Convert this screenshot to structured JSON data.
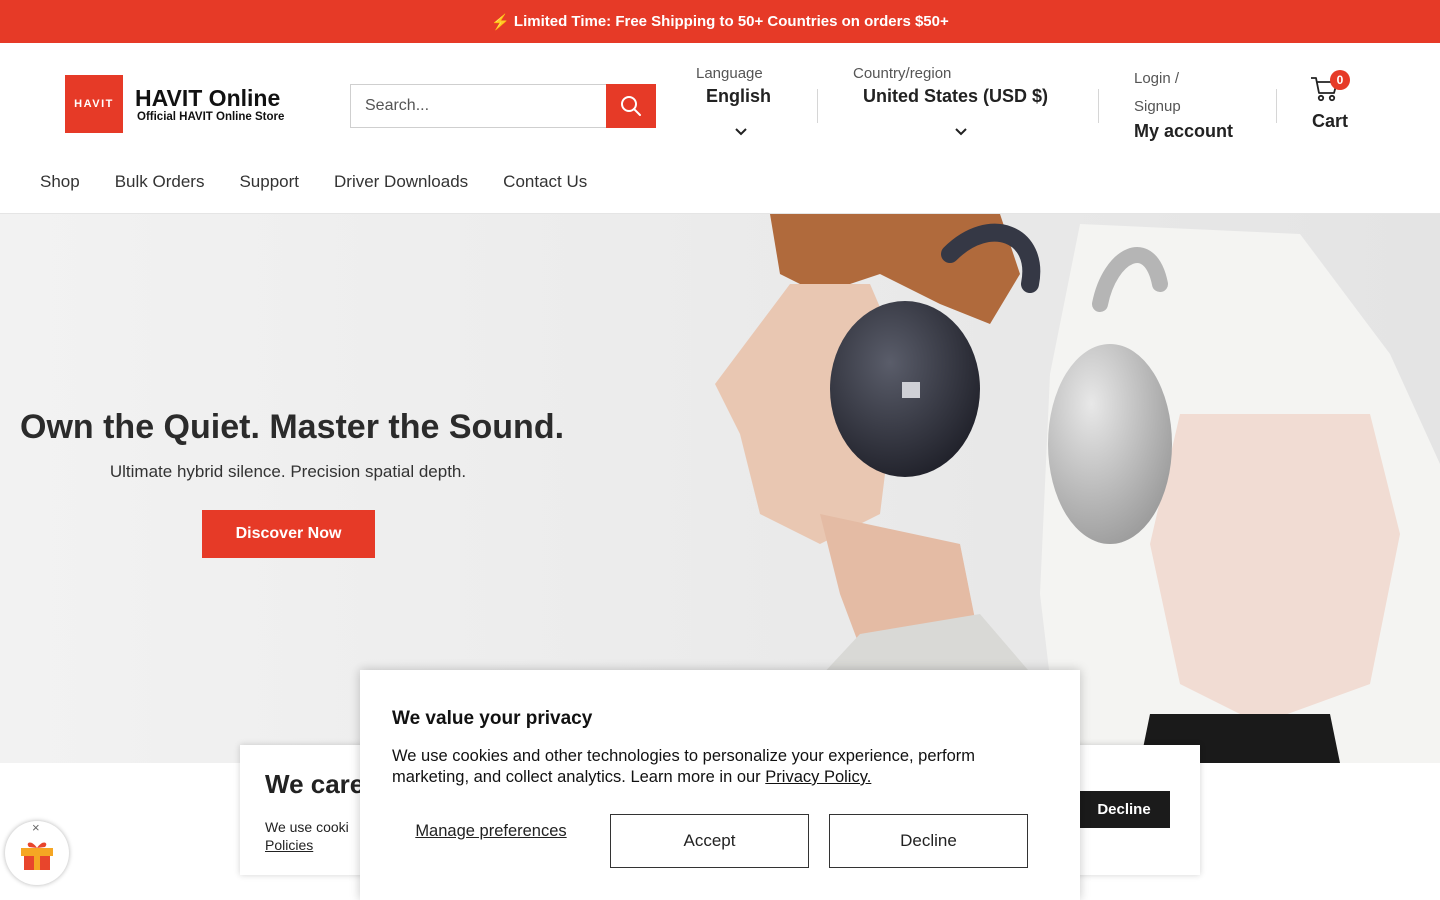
{
  "promo": {
    "icon": "lightning-icon",
    "bolt": "⚡",
    "text": "Limited Time: Free Shipping to 50+ Countries on orders $50+"
  },
  "header": {
    "logo": {
      "box_text": "HAVIT",
      "title": "HAVIT Online",
      "subtitle": "Official HAVIT Online Store"
    },
    "search": {
      "placeholder": "Search..."
    },
    "language": {
      "label": "Language",
      "value": "English"
    },
    "region": {
      "label": "Country/region",
      "value": "United States (USD $)"
    },
    "account": {
      "login": "Login / Signup",
      "my_account": "My account"
    },
    "cart": {
      "count": "0",
      "label": "Cart"
    }
  },
  "nav": {
    "items": [
      "Shop",
      "Bulk Orders",
      "Support",
      "Driver Downloads",
      "Contact Us"
    ]
  },
  "hero": {
    "title": "Own the Quiet. Master the Sound.",
    "subtitle": "Ultimate hybrid silence. Precision spatial depth.",
    "cta": "Discover Now"
  },
  "care_banner": {
    "title": "We care",
    "text": "We use cooki",
    "link": "Policies",
    "decline": "Decline"
  },
  "privacy": {
    "title": "We value your privacy",
    "text": "We use cookies and other technologies to personalize your experience, perform marketing, and collect analytics. Learn more in our",
    "link": "Privacy Policy.",
    "manage": "Manage preferences",
    "accept": "Accept",
    "decline": "Decline"
  },
  "gift": {
    "close": "×"
  },
  "colors": {
    "brand": "#e63a27",
    "dark_button": "#1b1b1b"
  }
}
